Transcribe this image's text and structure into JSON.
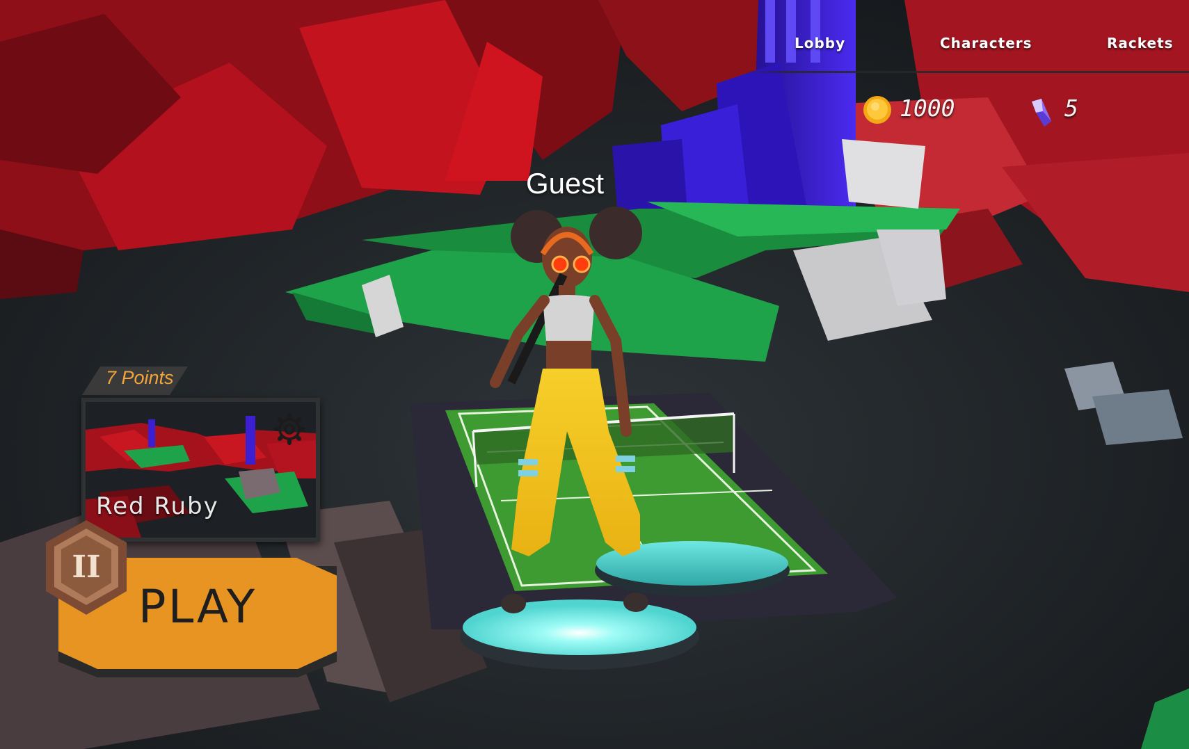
{
  "nav": {
    "tabs": [
      {
        "label": "Lobby"
      },
      {
        "label": "Characters"
      },
      {
        "label": "Rackets"
      }
    ]
  },
  "currency": {
    "coins": {
      "icon": "coin-icon",
      "value": "1000"
    },
    "gems": {
      "icon": "crystal-icon",
      "value": "5"
    }
  },
  "player": {
    "name": "Guest"
  },
  "level": {
    "points_label": "7 Points",
    "name": "Red Ruby",
    "settings_icon": "gear-icon"
  },
  "play": {
    "label": "PLAY",
    "rank_badge": "II",
    "rank_icon": "rank-badge-icon"
  },
  "colors": {
    "accent": "#e79422",
    "points_text": "#f2a43a",
    "rocks": "#a8121c",
    "grass": "#1fa34a",
    "tower": "#3b1fd1",
    "pad": "#4fd4d0",
    "outfit": "#f3c21b"
  }
}
